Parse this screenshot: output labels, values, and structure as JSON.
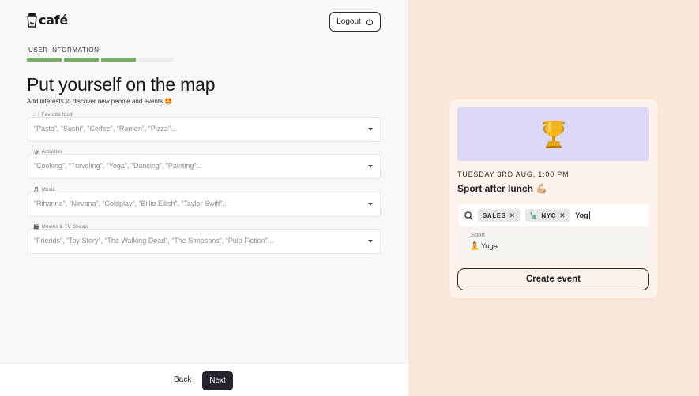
{
  "brand": {
    "name": "café",
    "logo_icon": "cup-icon"
  },
  "header": {
    "logout_label": "Logout",
    "logout_icon": "power-icon"
  },
  "step": {
    "label": "USER INFORMATION",
    "progress_segments": 4,
    "progress_completed": 3,
    "accent": "#7aaa67"
  },
  "main": {
    "title": "Put yourself on the map",
    "subtitle": "Add interests to discover new people and events 🤩",
    "fields": [
      {
        "emoji": "🍽️",
        "label": "Favorite food",
        "placeholder": "“Pasta”, “Sushi”, “Coffee”, “Ramen”, “Pizza”..."
      },
      {
        "emoji": "🎲",
        "label": "Activities",
        "placeholder": "“Cooking”, “Traveling”, “Yoga”, “Dancing”, “Painting”..."
      },
      {
        "emoji": "🎵",
        "label": "Music",
        "placeholder": "“Rihanna”, “Nirvana”, “Coldplay”, “Billie Eilish”, “Taylor Swift”..."
      },
      {
        "emoji": "🎬",
        "label": "Movies & TV Shows",
        "placeholder": "“Friends”, “Toy Story”, “The Walking Dead”, “The Simpsons”, “Pulp Fiction”..."
      }
    ]
  },
  "footer": {
    "back_label": "Back",
    "next_label": "Next"
  },
  "preview": {
    "banner_icon": "trophy-icon",
    "banner_emoji": "🏆",
    "date": "TUESDAY 3RD AUG, 1:00 PM",
    "title": "Sport after lunch 💪🏼",
    "search": {
      "icon": "search-icon",
      "tags": [
        {
          "label": "SALES",
          "emoji": ""
        },
        {
          "label": "NYC",
          "emoji": "🗽"
        }
      ],
      "typed": "Yog"
    },
    "dropdown": {
      "group": "Sport",
      "option": "Yoga",
      "option_emoji": "🧘"
    },
    "create_label": "Create event"
  },
  "colors": {
    "left_bg": "#f8f8fa",
    "right_bg": "#fbe7da",
    "banner_bg": "#dcd8f8",
    "dark_button": "#25242c"
  }
}
